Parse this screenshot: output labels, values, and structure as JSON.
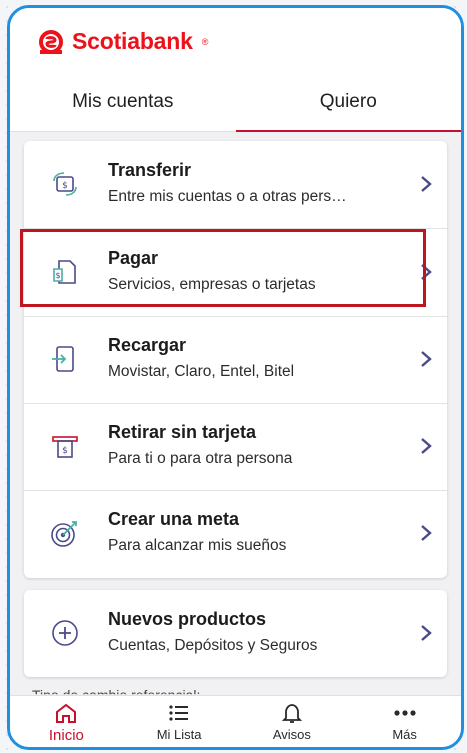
{
  "brand": {
    "name": "Scotiabank",
    "reg": "®",
    "color": "#ec111a"
  },
  "tabs": [
    {
      "label": "Mis cuentas",
      "active": false
    },
    {
      "label": "Quiero",
      "active": true
    }
  ],
  "actions": [
    {
      "title": "Transferir",
      "subtitle": "Entre mis cuentas o a otras pers…",
      "icon": "transfer-icon"
    },
    {
      "title": "Pagar",
      "subtitle": "Servicios, empresas o tarjetas",
      "icon": "pay-bill-icon",
      "highlighted": true
    },
    {
      "title": "Recargar",
      "subtitle": "Movistar, Claro, Entel, Bitel",
      "icon": "recharge-icon"
    },
    {
      "title": "Retirar sin tarjeta",
      "subtitle": "Para ti o para otra persona",
      "icon": "cash-withdraw-icon"
    },
    {
      "title": "Crear una meta",
      "subtitle": "Para alcanzar mis sueños",
      "icon": "target-icon"
    }
  ],
  "products": {
    "title": "Nuevos productos",
    "subtitle": "Cuentas, Depósitos y Seguros",
    "icon": "plus-circle-icon"
  },
  "fx_label": "Tipo de cambio referencial:",
  "bottom_nav": [
    {
      "label": "Inicio",
      "icon": "home-icon",
      "active": true
    },
    {
      "label": "Mi Lista",
      "icon": "list-icon",
      "active": false
    },
    {
      "label": "Avisos",
      "icon": "bell-icon",
      "active": false
    },
    {
      "label": "Más",
      "icon": "more-icon",
      "active": false
    }
  ],
  "colors": {
    "accent": "#c8102e",
    "icon": "#4a4a8a",
    "frame": "#1f8fe0"
  }
}
